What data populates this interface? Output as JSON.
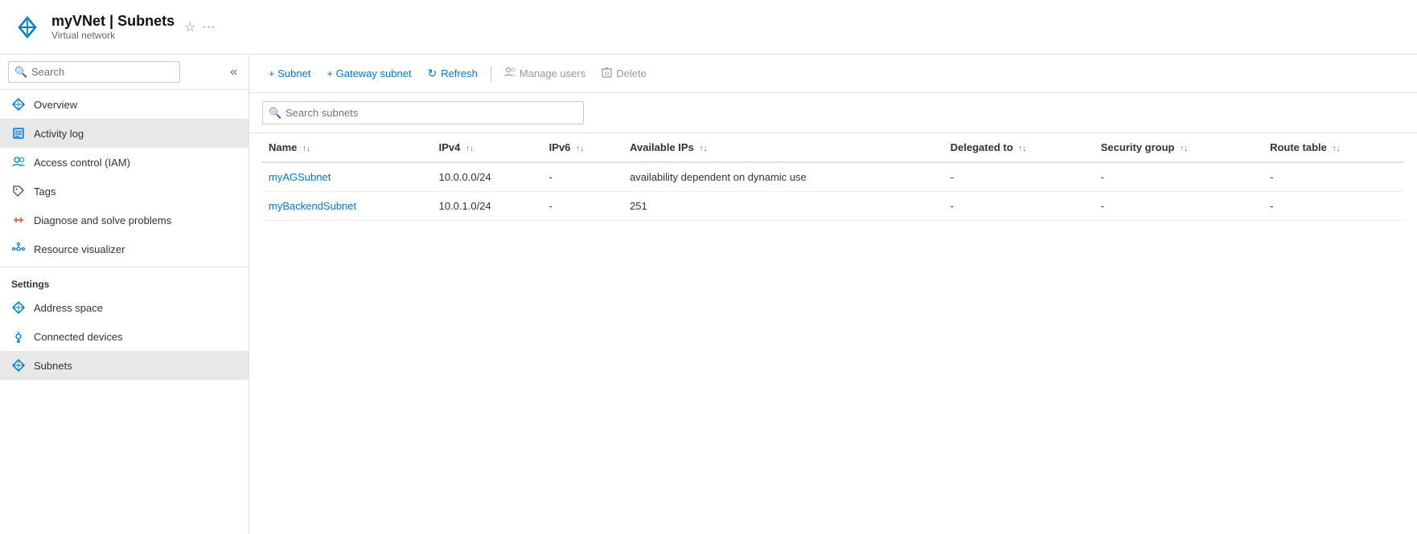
{
  "header": {
    "resource_name": "myVNet",
    "separator": "|",
    "page_title": "Subnets",
    "subtitle": "Virtual network"
  },
  "sidebar": {
    "search_placeholder": "Search",
    "collapse_icon": "«",
    "nav_items": [
      {
        "id": "overview",
        "label": "Overview",
        "icon": "diamond"
      },
      {
        "id": "activity-log",
        "label": "Activity log",
        "icon": "list",
        "active": true
      },
      {
        "id": "access-control",
        "label": "Access control (IAM)",
        "icon": "people"
      },
      {
        "id": "tags",
        "label": "Tags",
        "icon": "tag"
      },
      {
        "id": "diagnose",
        "label": "Diagnose and solve problems",
        "icon": "wrench"
      },
      {
        "id": "resource-visualizer",
        "label": "Resource visualizer",
        "icon": "hierarchy"
      }
    ],
    "settings_header": "Settings",
    "settings_items": [
      {
        "id": "address-space",
        "label": "Address space",
        "icon": "diamond"
      },
      {
        "id": "connected-devices",
        "label": "Connected devices",
        "icon": "plug"
      },
      {
        "id": "subnets",
        "label": "Subnets",
        "icon": "diamond",
        "active": true
      }
    ]
  },
  "toolbar": {
    "add_subnet_label": "+ Subnet",
    "add_gateway_label": "+ Gateway subnet",
    "refresh_label": "Refresh",
    "manage_users_label": "Manage users",
    "delete_label": "Delete"
  },
  "search": {
    "placeholder": "Search subnets"
  },
  "table": {
    "columns": [
      {
        "key": "name",
        "label": "Name"
      },
      {
        "key": "ipv4",
        "label": "IPv4"
      },
      {
        "key": "ipv6",
        "label": "IPv6"
      },
      {
        "key": "available_ips",
        "label": "Available IPs"
      },
      {
        "key": "delegated_to",
        "label": "Delegated to"
      },
      {
        "key": "security_group",
        "label": "Security group"
      },
      {
        "key": "route_table",
        "label": "Route table"
      }
    ],
    "rows": [
      {
        "name": "myAGSubnet",
        "ipv4": "10.0.0.0/24",
        "ipv6": "-",
        "available_ips": "availability dependent on dynamic use",
        "delegated_to": "-",
        "security_group": "-",
        "route_table": "-"
      },
      {
        "name": "myBackendSubnet",
        "ipv4": "10.0.1.0/24",
        "ipv6": "-",
        "available_ips": "251",
        "delegated_to": "-",
        "security_group": "-",
        "route_table": "-"
      }
    ]
  }
}
